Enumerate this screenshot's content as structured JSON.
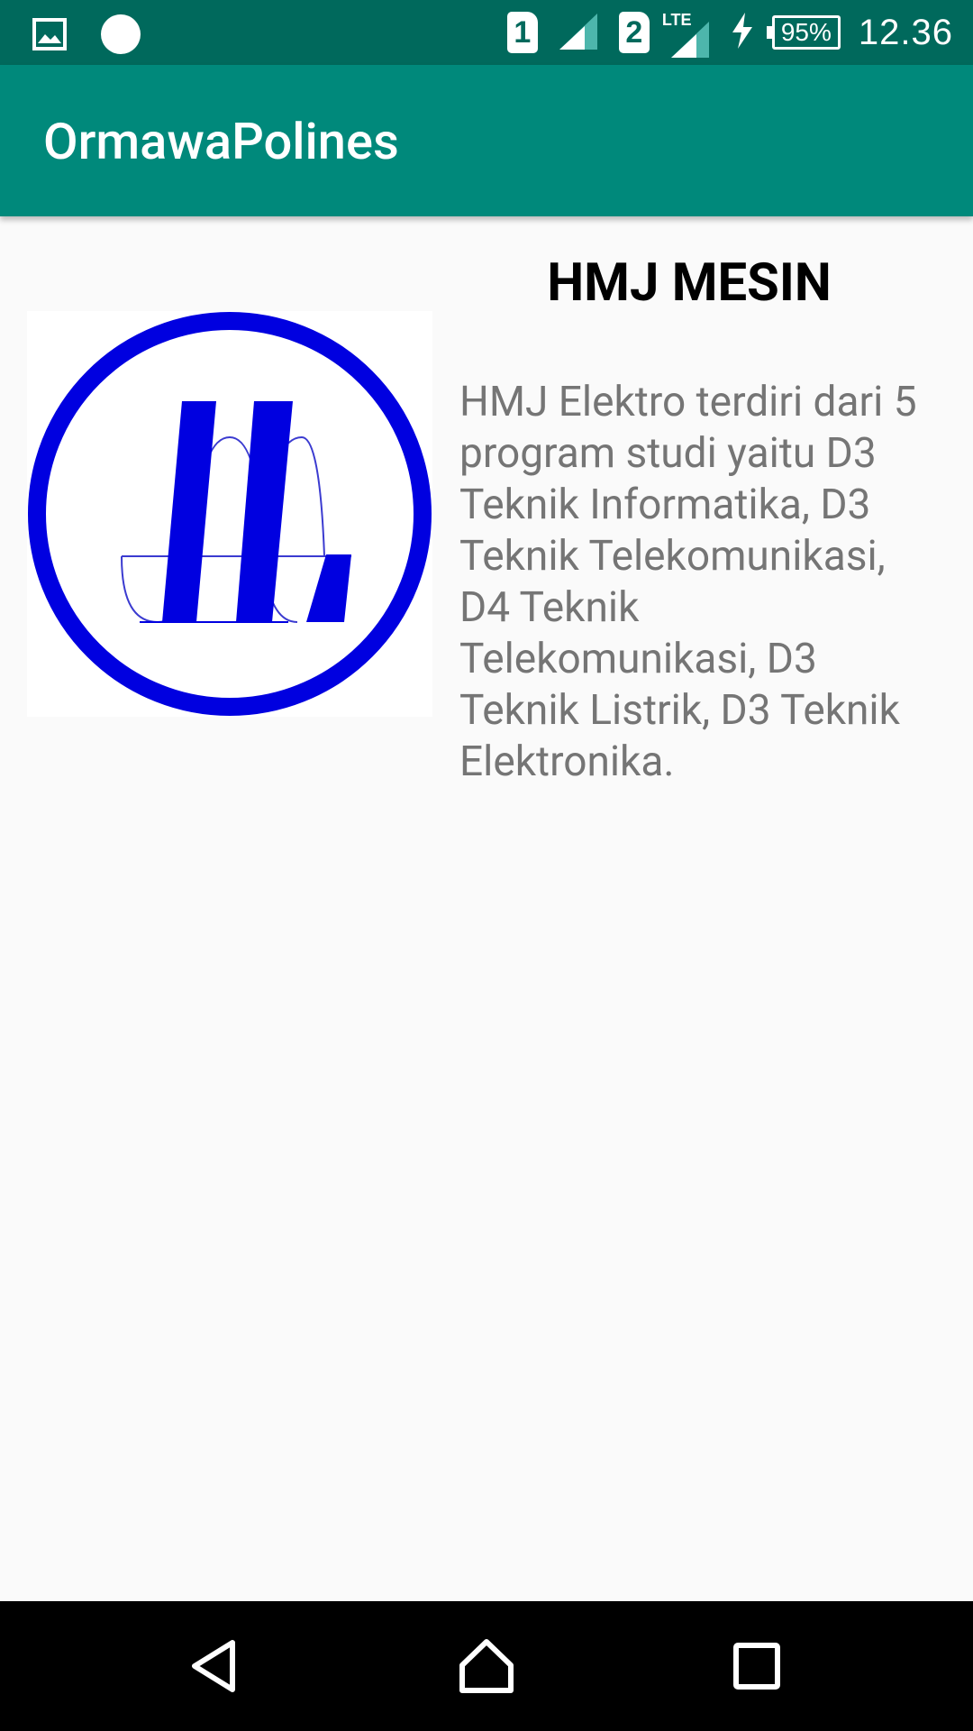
{
  "status_bar": {
    "sim1": "1",
    "sim2": "2",
    "network": "LTE",
    "battery": "95%",
    "time": "12.36",
    "icons": [
      "gallery-notification-icon",
      "dot-notification-icon",
      "signal-icon",
      "charging-icon"
    ]
  },
  "app_bar": {
    "title": "OrmawaPolines",
    "color": "#00897b"
  },
  "content": {
    "title": "HMJ MESIN",
    "description": "HMJ Elektro terdiri dari 5 program studi yaitu D3 Teknik Informatika, D3 Teknik Telekomunikasi, D4 Teknik Telekomunikasi, D3 Teknik Listrik, D3 Teknik Elektronika.",
    "logo_color": "#0000e0"
  },
  "nav_bar": {
    "back": "back-icon",
    "home": "home-icon",
    "recents": "recents-icon"
  }
}
